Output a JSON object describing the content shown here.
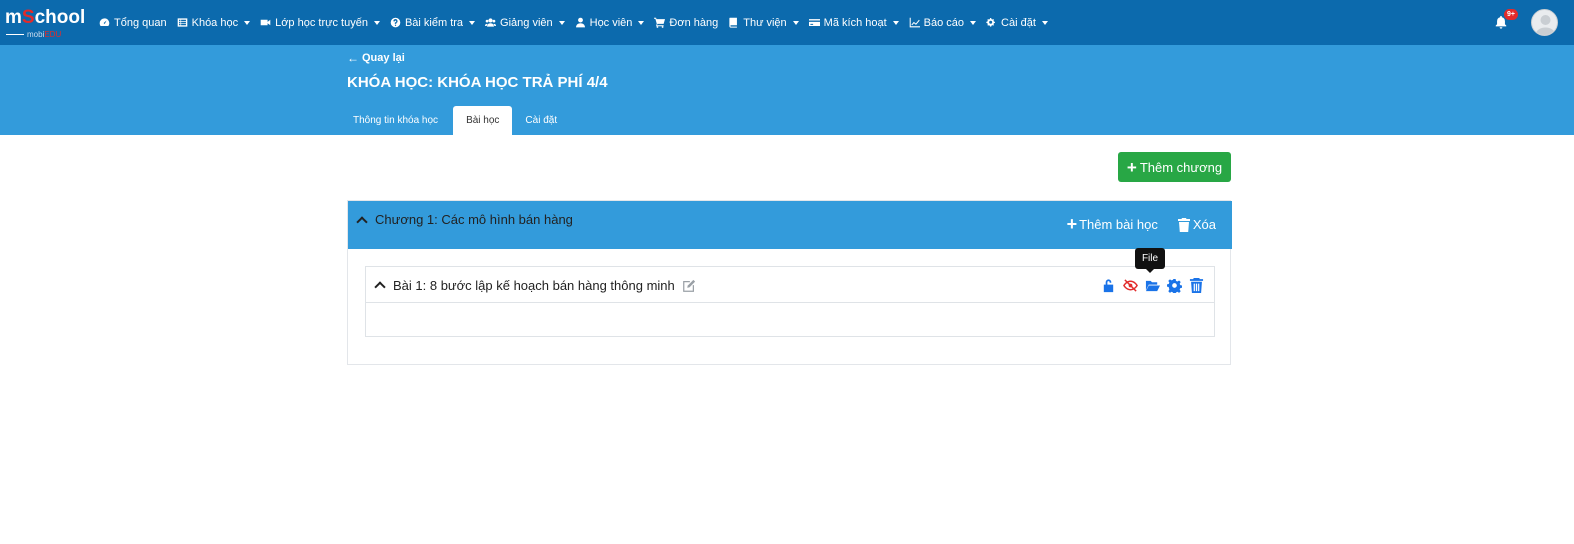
{
  "brand": {
    "logo_main_a": "m",
    "logo_main_b": "S",
    "logo_main_c": "chool",
    "logo_sub_a": "mobi",
    "logo_sub_b": "EDU"
  },
  "nav": {
    "items": [
      {
        "label": "Tổng quan",
        "icon": "dashboard-icon",
        "dropdown": false
      },
      {
        "label": "Khóa học",
        "icon": "list-icon",
        "dropdown": true
      },
      {
        "label": "Lớp học trực tuyến",
        "icon": "video-icon",
        "dropdown": true
      },
      {
        "label": "Bài kiểm tra",
        "icon": "question-icon",
        "dropdown": true
      },
      {
        "label": "Giảng viên",
        "icon": "users-icon",
        "dropdown": true
      },
      {
        "label": "Học viên",
        "icon": "user-icon",
        "dropdown": true
      },
      {
        "label": "Đơn hàng",
        "icon": "cart-icon",
        "dropdown": false
      },
      {
        "label": "Thư viện",
        "icon": "book-icon",
        "dropdown": true
      },
      {
        "label": "Mã kích hoạt",
        "icon": "card-icon",
        "dropdown": true
      },
      {
        "label": "Báo cáo",
        "icon": "chart-icon",
        "dropdown": true
      },
      {
        "label": "Cài đặt",
        "icon": "cogs-icon",
        "dropdown": true
      }
    ],
    "notifications_badge": "9+"
  },
  "header": {
    "back_label": "Quay lại",
    "course_title": "KHÓA HỌC: KHÓA HỌC TRẢ PHÍ 4/4",
    "tabs": [
      {
        "label": "Thông tin khóa học",
        "active": false
      },
      {
        "label": "Bài học",
        "active": true
      },
      {
        "label": "Cài đặt",
        "active": false
      }
    ]
  },
  "main": {
    "add_chapter_label": "Thêm chương",
    "chapter": {
      "title": "Chương 1: Các mô hình bán hàng",
      "add_lesson_label": "Thêm bài học",
      "delete_label": "Xóa",
      "lesson": {
        "title": "Bài 1: 8 bước lập kế hoạch bán hàng thông minh"
      }
    },
    "tooltip_label": "File"
  },
  "colors": {
    "navbar": "#0c6aad",
    "header": "#339bdb",
    "green": "#28a745",
    "icon_blue": "#1a73e8",
    "icon_red": "#e22b2b"
  }
}
